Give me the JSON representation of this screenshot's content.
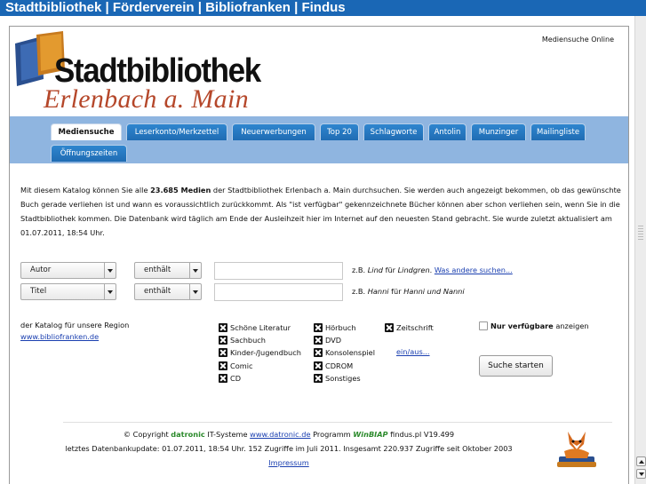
{
  "topbar": {
    "title": "Stadtbibliothek | Förderverein | Bibliofranken | Findus"
  },
  "header": {
    "corner_label": "Mediensuche Online",
    "logo_title": "Stadtbibliothek",
    "logo_subtitle": "Erlenbach a. Main"
  },
  "tabs": [
    {
      "label": "Mediensuche",
      "active": true
    },
    {
      "label": "Leserkonto/Merkzettel"
    },
    {
      "label": "Neuerwerbungen"
    },
    {
      "label": "Top 20"
    },
    {
      "label": "Schlagworte"
    },
    {
      "label": "Antolin"
    },
    {
      "label": "Munzinger"
    },
    {
      "label": "Mailingliste"
    },
    {
      "label": "Öffnungszeiten"
    }
  ],
  "intro": {
    "part1": "Mit diesem Katalog können Sie alle ",
    "count": "23.685 Medien",
    "part2": " der Stadtbibliothek Erlenbach a. Main durchsuchen. Sie werden auch angezeigt bekommen, ob das gewünschte Buch gerade verliehen ist und wann es voraussichtlich zurückkommt. Als \"ist verfügbar\" gekennzeichnete Bücher können aber schon verliehen sein, wenn Sie in die Stadtbibliothek kommen. Die Datenbank wird täglich am Ende der Ausleihzeit hier im Internet auf den neuesten Stand gebracht. Sie wurde zuletzt aktualisiert am 01.07.2011, 18:54 Uhr."
  },
  "search": {
    "row1": {
      "field": "Autor",
      "operator": "enthält",
      "value": "",
      "hint_prefix": "z.B. ",
      "hint_example": "Lind",
      "hint_mid": " für ",
      "hint_target": "Lindgren",
      "hint_suffix": ". ",
      "link": "Was andere suchen..."
    },
    "row2": {
      "field": "Titel",
      "operator": "enthält",
      "value": "",
      "hint_prefix": "z.B. ",
      "hint_example": "Hanni",
      "hint_mid": " für ",
      "hint_target": "Hanni und Nanni"
    }
  },
  "region": {
    "text": "der Katalog für unsere Region",
    "link": "www.bibliofranken.de"
  },
  "media_types": {
    "col1": [
      "Schöne Literatur",
      "Sachbuch",
      "Kinder-/Jugendbuch",
      "Comic",
      "CD"
    ],
    "col2": [
      "Hörbuch",
      "DVD",
      "Konsolenspiel",
      "CDROM",
      "Sonstiges"
    ],
    "col3": [
      "Zeitschrift"
    ],
    "toggle_link": "ein/aus..."
  },
  "available_only": {
    "bold": "Nur verfügbare",
    "rest": " anzeigen",
    "checked": false
  },
  "submit_label": "Suche starten",
  "footer": {
    "copyright": "© Copyright ",
    "company": "datronic",
    "company_rest": " IT-Systeme ",
    "company_link": "www.datronic.de",
    "program": "  Programm ",
    "win": "Win",
    "biap": "BIAP",
    "version": " findus.pl V19.499",
    "line2": "letztes Datenbankupdate: 01.07.2011, 18:54 Uhr. 152 Zugriffe im Juli 2011. Insgesamt 220.937 Zugriffe seit Oktober 2003",
    "impressum": "Impressum"
  }
}
